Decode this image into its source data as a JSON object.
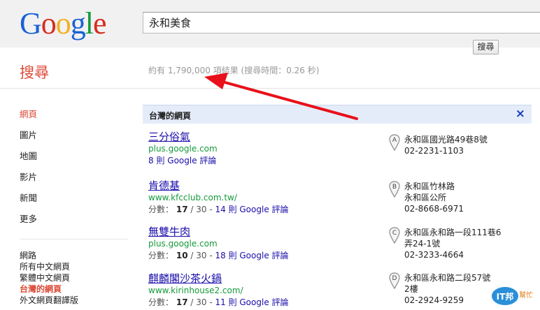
{
  "logo": {
    "letters": [
      "G",
      "o",
      "o",
      "g",
      "l",
      "e"
    ]
  },
  "search": {
    "query": "永和美食",
    "button_label": "搜尋"
  },
  "section_title": "搜尋",
  "stats": "約有 1,790,000 項結果 (搜尋時間：0.26 秒)",
  "nav": {
    "main": [
      {
        "label": "網頁",
        "active": true
      },
      {
        "label": "圖片",
        "active": false
      },
      {
        "label": "地圖",
        "active": false
      },
      {
        "label": "影片",
        "active": false
      },
      {
        "label": "新聞",
        "active": false
      },
      {
        "label": "更多",
        "active": false
      }
    ],
    "sub": [
      {
        "label": "網路",
        "active": false
      },
      {
        "label": "所有中文網頁",
        "active": false
      },
      {
        "label": "繁體中文網頁",
        "active": false
      },
      {
        "label": "台灣的網頁",
        "active": true
      },
      {
        "label": "外文網頁翻譯版",
        "active": false
      }
    ]
  },
  "panel": {
    "title": "台灣的網頁",
    "close": "×"
  },
  "results": [
    {
      "title": "三分俗氣",
      "url": "plus.google.com",
      "score": "",
      "score_total": "",
      "reviews": "8 則 Google 評論",
      "pin": "A",
      "address": [
        "永和區國光路49巷8號",
        "02-2231-1103"
      ]
    },
    {
      "title": "肯德基",
      "url": "www.kfcclub.com.tw/",
      "score": "17",
      "score_total": "/ 30 -",
      "reviews": "14 則 Google 評論",
      "pin": "B",
      "address": [
        "永和區竹林路",
        "永和區公所",
        "02-8668-6971"
      ]
    },
    {
      "title": "無雙牛肉",
      "url": "plus.google.com",
      "score": "10",
      "score_total": "/ 30 -",
      "reviews": "18 則 Google 評論",
      "pin": "C",
      "address": [
        "永和區永和路一段111巷6",
        "弄24-1號",
        "02-3233-4664"
      ]
    },
    {
      "title": "麒麟閣沙茶火鍋",
      "url": "www.kirinhouse2.com/",
      "score": "17",
      "score_total": "/ 30 -",
      "reviews": "11 則 Google 評論",
      "pin": "D",
      "address": [
        "永和區永和路二段57號",
        "2樓",
        "02-2924-9259"
      ]
    }
  ],
  "score_label": "分數：",
  "watermark": {
    "text": "IT邦",
    "sub": "幫忙"
  },
  "colors": {
    "accent_red": "#dd4b39",
    "link_blue": "#1a0dab",
    "url_green": "#159a3a",
    "arrow": "#e8101a"
  }
}
